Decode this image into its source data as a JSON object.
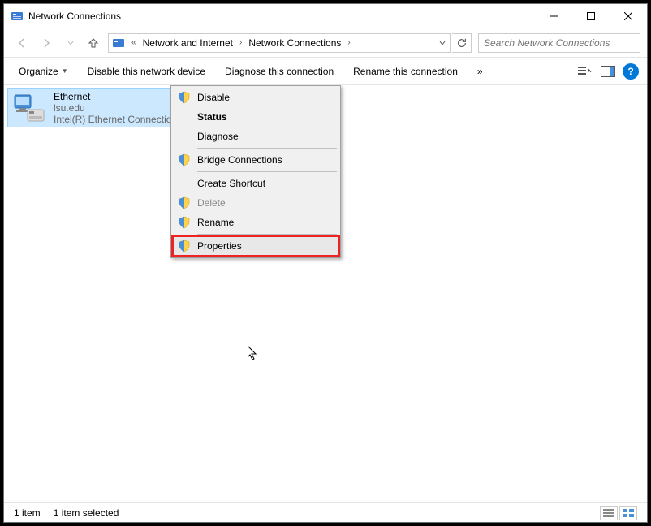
{
  "title": "Network Connections",
  "breadcrumb": {
    "prefix": "«",
    "seg1": "Network and Internet",
    "seg2": "Network Connections"
  },
  "search": {
    "placeholder": "Search Network Connections"
  },
  "toolbar": {
    "organize": "Organize",
    "disable": "Disable this network device",
    "diagnose": "Diagnose this connection",
    "rename": "Rename this connection",
    "overflow": "»"
  },
  "adapter": {
    "name": "Ethernet",
    "domain": "lsu.edu",
    "device": "Intel(R) Ethernet Connection"
  },
  "context_menu": {
    "disable": "Disable",
    "status": "Status",
    "diagnose": "Diagnose",
    "bridge": "Bridge Connections",
    "shortcut": "Create Shortcut",
    "delete": "Delete",
    "rename": "Rename",
    "properties": "Properties"
  },
  "statusbar": {
    "count": "1 item",
    "selected": "1 item selected"
  }
}
